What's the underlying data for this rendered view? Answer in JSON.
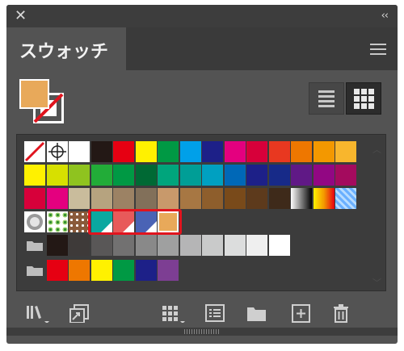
{
  "window": {
    "close_icon": "close-icon",
    "collapse_label": "‹‹"
  },
  "panel": {
    "tab_label": "スウォッチ",
    "menu_icon": "hamburger-menu-icon"
  },
  "fill_stroke": {
    "fill_color": "#E8A95A",
    "stroke": "none"
  },
  "view_mode": {
    "options": [
      "list-view",
      "thumbnail-view"
    ],
    "selected": "thumbnail-view"
  },
  "swatch_rows": [
    [
      "none",
      "registration",
      "#FFFFFF",
      "#231815",
      "#E60012",
      "#FFF100",
      "#009944",
      "#00A0E9",
      "#1D2088",
      "#E4007F",
      "#D7003A",
      "#E83820",
      "#EE7700",
      "#F39800",
      "#F8B62D"
    ],
    [
      "#FFF100",
      "#D7E000",
      "#8FC31F",
      "#22AC38",
      "#009944",
      "#006934",
      "#00A57C",
      "#009E96",
      "#00A0C1",
      "#0068B7",
      "#1D2088",
      "#172A88",
      "#601986",
      "#920783",
      "#A40B5E"
    ],
    [
      "#D7003A",
      "#E4007F",
      "#C9BC9C",
      "#B6A37F",
      "#9C8264",
      "#82705A",
      "#C8996B",
      "#A77743",
      "#8E5E2C",
      "#794A1A",
      "#5D3A1C",
      "#3E2A1A",
      "gradient-bw",
      "gradient-orange",
      "pattern-blue"
    ],
    [
      "pattern-circle",
      "pattern-green",
      "pattern-brown",
      "#0AA8A0",
      "#E85A5A",
      "#4A63B5",
      "#E8A95A"
    ],
    [
      "group",
      "#231815",
      "#3E3A39",
      "#595757",
      "#727171",
      "#898989",
      "#9FA0A0",
      "#B5B5B6",
      "#C9CACA",
      "#DCDDDD",
      "#EFEFEF",
      "#FFFFFF"
    ],
    [
      "group",
      "#E60012",
      "#EE7700",
      "#FFF100",
      "#009944",
      "#1D2088",
      "#7D3E93"
    ]
  ],
  "highlight_group": {
    "color": "#E0141E",
    "row": 3,
    "from": 3,
    "to": 6
  },
  "toolbar": {
    "items": [
      "swatch-library-icon",
      "import-swatches-icon",
      "swatch-kind-icon",
      "swatch-options-icon",
      "new-color-group-icon",
      "new-swatch-icon",
      "delete-swatch-icon"
    ]
  }
}
